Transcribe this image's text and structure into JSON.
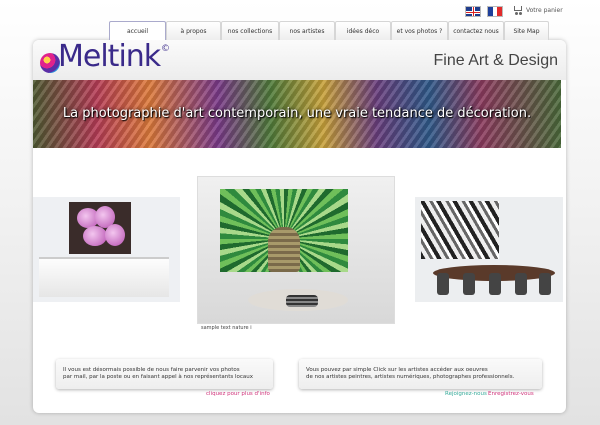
{
  "languages": [
    {
      "name": "English",
      "icon": "uk-flag-icon"
    },
    {
      "name": "Français",
      "icon": "fr-flag-icon"
    }
  ],
  "cart": {
    "label": "Votre panier",
    "icon": "cart-icon"
  },
  "nav": [
    {
      "label": "accueil",
      "active": true
    },
    {
      "label": "à propos"
    },
    {
      "label": "nos collections"
    },
    {
      "label": "nos artistes"
    },
    {
      "label": "idées déco"
    },
    {
      "label": "et vos photos ?"
    },
    {
      "label": "contactez nous"
    },
    {
      "label": "Site Map"
    }
  ],
  "logo": {
    "text": "Meltink",
    "symbol": "©"
  },
  "tagline": "Fine Art & Design",
  "banner": {
    "text": "La photographie d'art contemporain, une vraie tendance de décoration."
  },
  "gallery": {
    "caption": "sample text nature i"
  },
  "info_left": {
    "line1": "Il vous  est désormais possible de nous faire parvenir vos photos",
    "line2": "par mail, par la poste ou en faisant appel à nos représentants locaux",
    "link": "cliquez pour plus d'info"
  },
  "info_right": {
    "line1": "Vous pouvez par simple Click sur les artistes accéder aux oeuvres",
    "line2": "de nos artistes  peintres, artistes numériques, photographes professionnels.",
    "link_join": "Rejoignez-nous",
    "link_register": "Enregistrez-vous"
  },
  "colors": {
    "brand": "#3a2a8a",
    "link_pink": "#d0327a",
    "link_teal": "#33aa99"
  }
}
